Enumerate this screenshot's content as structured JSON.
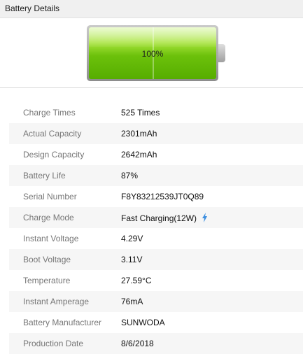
{
  "window": {
    "title": "Battery Details"
  },
  "battery": {
    "percent_label": "100%",
    "level": 1.0,
    "fill_color": "#6cc10b"
  },
  "details": [
    {
      "label": "Charge Times",
      "value": "525 Times"
    },
    {
      "label": "Actual Capacity",
      "value": "2301mAh"
    },
    {
      "label": "Design Capacity",
      "value": "2642mAh"
    },
    {
      "label": "Battery Life",
      "value": "87%"
    },
    {
      "label": "Serial Number",
      "value": "F8Y83212539JT0Q89"
    },
    {
      "label": "Charge Mode",
      "value": "Fast Charging(12W)",
      "icon": "lightning-bolt-icon"
    },
    {
      "label": "Instant Voltage",
      "value": "4.29V"
    },
    {
      "label": "Boot Voltage",
      "value": "3.11V"
    },
    {
      "label": "Temperature",
      "value": "27.59°C"
    },
    {
      "label": "Instant Amperage",
      "value": "76mA"
    },
    {
      "label": "Battery Manufacturer",
      "value": "SUNWODA"
    },
    {
      "label": "Production Date",
      "value": "8/6/2018"
    }
  ],
  "colors": {
    "accent_bolt": "#3d8fe0",
    "row_alt": "#f6f6f6"
  }
}
